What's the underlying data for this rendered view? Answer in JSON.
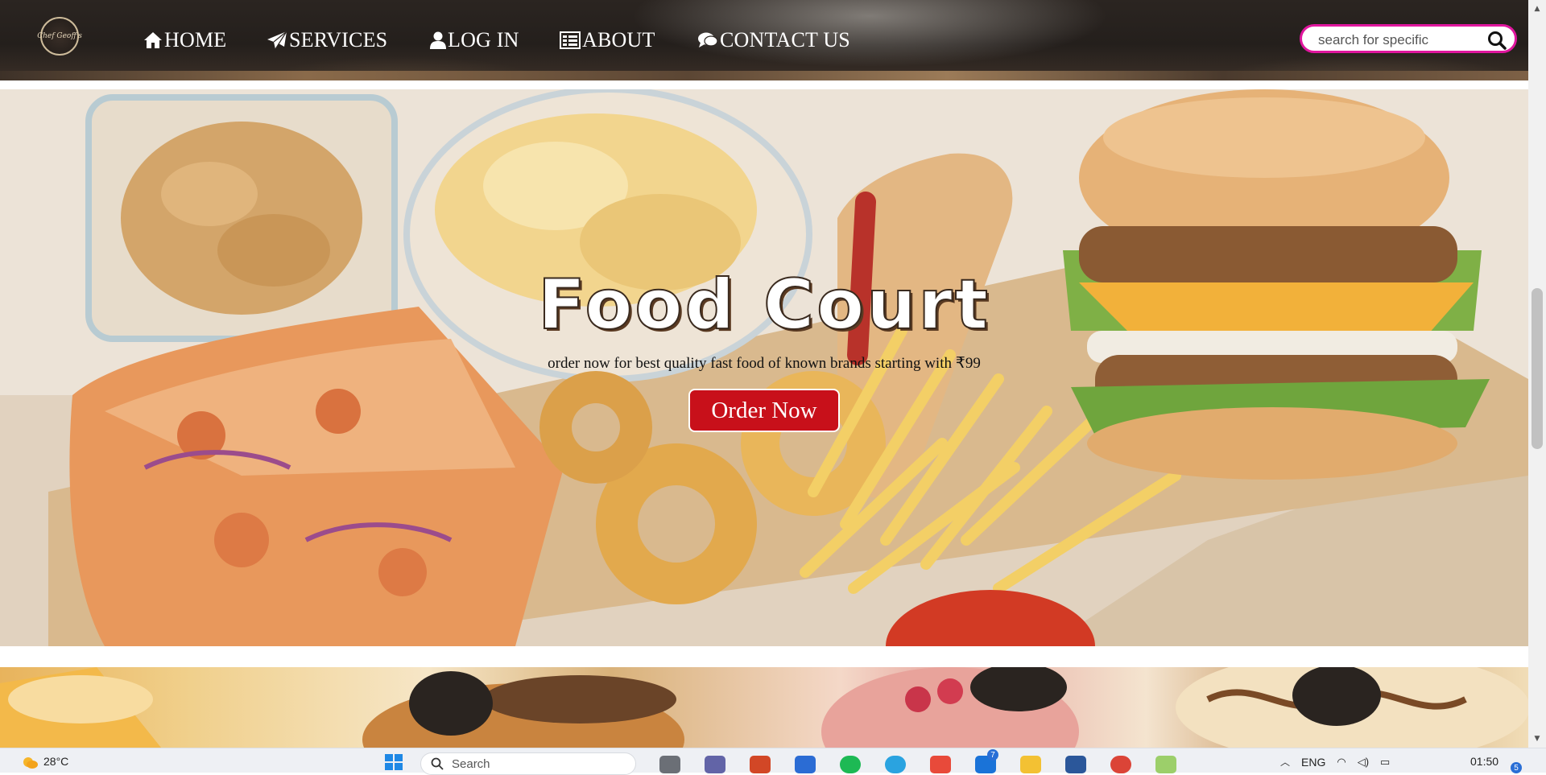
{
  "nav": {
    "logo_text": "Chef Geoff's",
    "items": [
      {
        "label": "HOME",
        "icon": "home-icon"
      },
      {
        "label": "SERVICES",
        "icon": "paper-plane-icon"
      },
      {
        "label": "LOG IN",
        "icon": "user-icon"
      },
      {
        "label": "ABOUT",
        "icon": "list-icon"
      },
      {
        "label": "CONTACT US",
        "icon": "chat-icon"
      }
    ],
    "search": {
      "placeholder": "search for specific",
      "icon": "search-icon"
    }
  },
  "hero": {
    "title": "Food Court",
    "subtitle": "order now for best quality fast food of known brands starting with ₹99",
    "button_label": "Order Now"
  },
  "taskbar": {
    "weather_temp": "28°C",
    "search_label": "Search",
    "badge_count": "7",
    "language": "ENG",
    "time": "01:50",
    "notification_count": "5"
  },
  "colors": {
    "accent_pink": "#e0169e",
    "button_red": "#c8101a",
    "nav_bg": "#2b2521"
  }
}
